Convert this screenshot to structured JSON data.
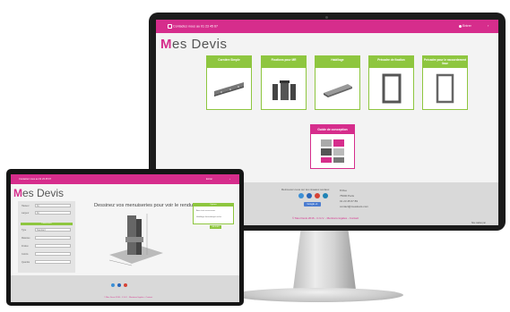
{
  "colors": {
    "brand": "#d62d8c",
    "accent": "#8ec63f",
    "footer": "#d9d9d9"
  },
  "desktop": {
    "topbar": {
      "contact": "Contactez nous au 01 23 45 67",
      "signin": "Entrer",
      "caret": "›"
    },
    "logo": {
      "first": "M",
      "rest": "es Devis"
    },
    "products": [
      {
        "label": "Cornière Simple",
        "icon": "rail-part-icon"
      },
      {
        "label": "Fixations pour MR",
        "icon": "bracket-icon"
      },
      {
        "label": "Habillage",
        "icon": "tray-icon"
      },
      {
        "label": "Précadre de fixation",
        "icon": "frame-icon"
      },
      {
        "label": "Précadre pour le raccordement lisse",
        "icon": "frame-icon"
      }
    ],
    "guide": {
      "label": "Guide de conception"
    },
    "footer": {
      "follow": "Retrouvez-nous sur les réseaux sociaux",
      "address_lines": [
        "8 Rue",
        "75000 Paris",
        "01 23 45 67 89",
        "contact@mesdevis.com"
      ],
      "google": "Google +1",
      "legal": "© Mes Devis 2016  -  C.G.V.  -  Mentions légales  -  Contact",
      "copy": "Site réalisé par"
    }
  },
  "mobile": {
    "topbar": {
      "contact": "Contactez nous au 01 23 45 67",
      "signin": "Entrer",
      "caret": "›"
    },
    "logo": {
      "first": "M",
      "rest": "es Devis"
    },
    "form": {
      "rows": [
        {
          "label": "Hauteur",
          "value": "60"
        },
        {
          "label": "Largeur",
          "value": "60"
        }
      ],
      "section": "Dimensions",
      "rows2": [
        {
          "label": "Type",
          "value": "Standard"
        },
        {
          "label": "Matériau",
          "value": ""
        },
        {
          "label": "Finition",
          "value": ""
        },
        {
          "label": "Coloris",
          "value": ""
        },
        {
          "label": "Quantité",
          "value": ""
        }
      ]
    },
    "title": "Dessinez vos menuiseries pour voir le rendu ?",
    "options": {
      "head": "Options",
      "items": [
        "Avec tout accessoires",
        "Habillage thermolaqué inclus"
      ]
    },
    "button": "VALIDER",
    "footer": {
      "legal": "© Mes Devis 2016  -  C.G.V.  -  Mentions légales  -  Contact"
    }
  }
}
